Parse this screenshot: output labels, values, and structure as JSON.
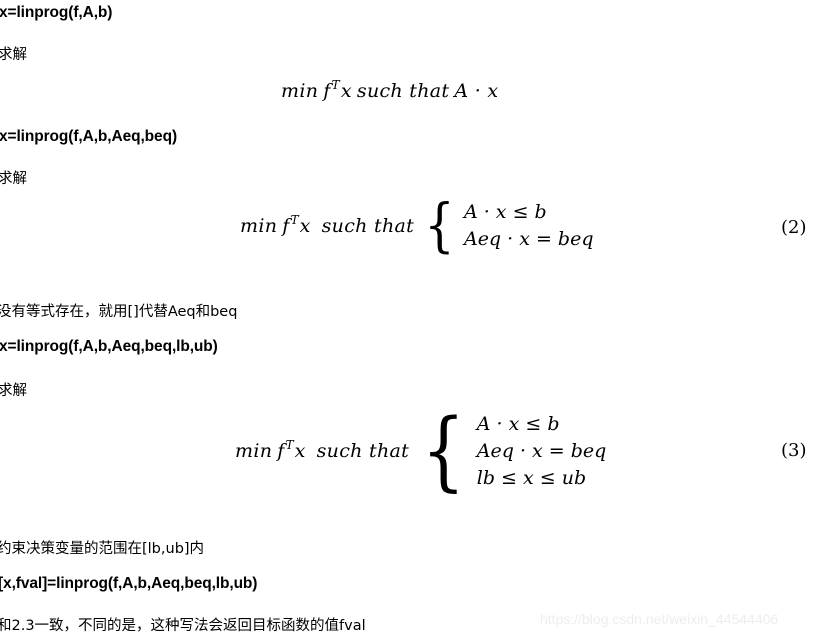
{
  "document": {
    "background_color": "#ffffff",
    "text_color": "#000000"
  },
  "blocks": {
    "heading_1": "x=linprog(f,A,b)",
    "label_1": "求解",
    "heading_2": "x=linprog(f,A,b,Aeq,beq)",
    "label_2": "求解",
    "note_1": "没有等式存在，就用[]代替Aeq和beq",
    "heading_3": "x=linprog(f,A,b,Aeq,beq,lb,ub)",
    "label_3": "求解",
    "note_2": "约束决策变量的范围在[lb,ub]内",
    "heading_4": "[x,fval]=linprog(f,A,b,Aeq,beq,lb,ub)",
    "note_3": "和2.3一致，不同的是，这种写法会返回目标函数的值fval"
  },
  "formula_1": {
    "lead_min": "min",
    "lead_f": "f",
    "lead_sup": "T",
    "lead_x": "x",
    "such_that": "such that",
    "expression": "A · x"
  },
  "formula_2": {
    "lead_min": "min",
    "lead_f": "f",
    "lead_sup": "T",
    "lead_x": "x",
    "such_that": "such that",
    "brace": "{",
    "constraints": [
      "A · x ≤ b",
      "Aeq · x = beq"
    ],
    "number": "(2)"
  },
  "formula_3": {
    "lead_min": "min",
    "lead_f": "f",
    "lead_sup": "T",
    "lead_x": "x",
    "such_that": "such that",
    "brace": "{",
    "constraints": [
      "A · x ≤ b",
      "Aeq · x = beq",
      "lb ≤ x ≤ ub"
    ],
    "number": "(3)"
  },
  "watermark": {
    "text": "https://blog.csdn.net/weixin_44544406",
    "color": "#ededed"
  }
}
